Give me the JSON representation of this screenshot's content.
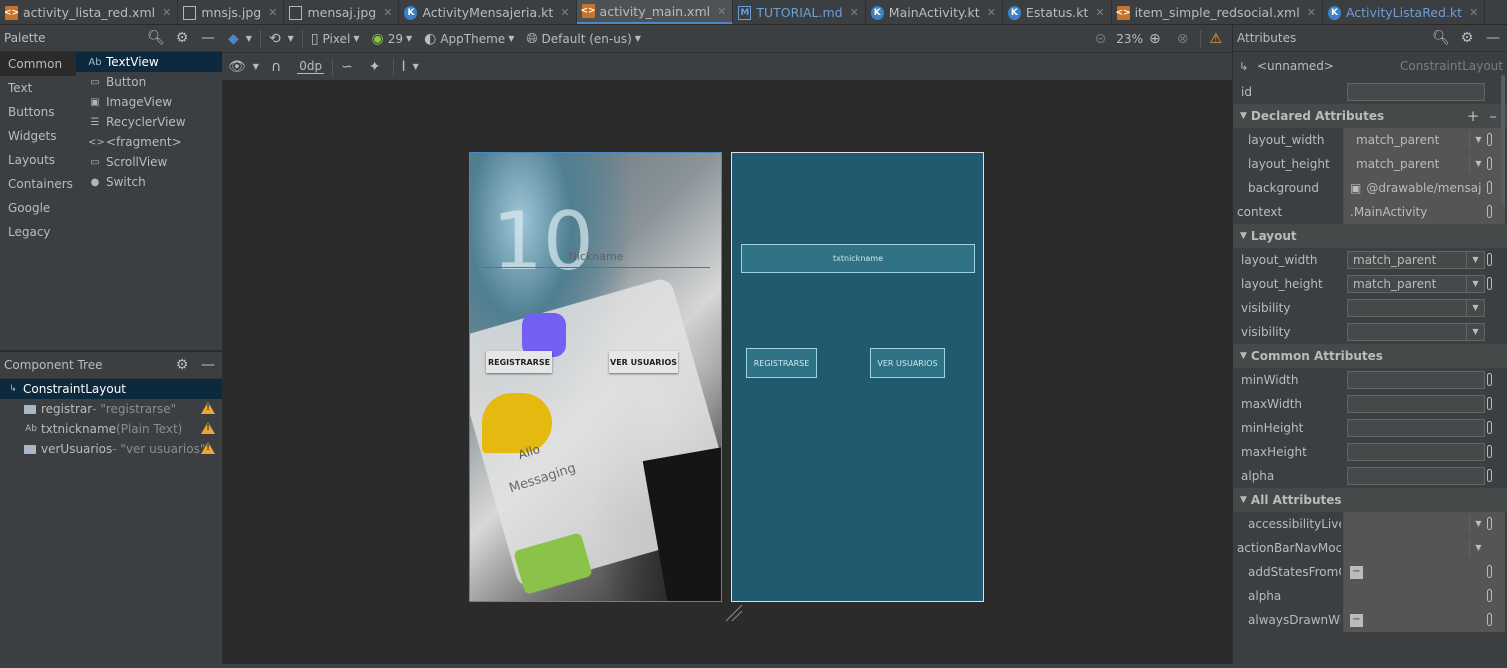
{
  "tabs": [
    {
      "label": "activity_lista_red.xml",
      "icon": "xml-file-icon",
      "kind": "xml",
      "active": false
    },
    {
      "label": "mnsjs.jpg",
      "icon": "image-file-icon",
      "kind": "img",
      "active": false
    },
    {
      "label": "mensaj.jpg",
      "icon": "image-file-icon",
      "kind": "img",
      "active": false
    },
    {
      "label": "ActivityMensajeria.kt",
      "icon": "kotlin-file-icon",
      "kind": "kt",
      "active": false
    },
    {
      "label": "activity_main.xml",
      "icon": "xml-file-icon",
      "kind": "xml",
      "active": true
    },
    {
      "label": "TUTORIAL.md",
      "icon": "markdown-file-icon",
      "kind": "md",
      "active": false,
      "blue": true
    },
    {
      "label": "MainActivity.kt",
      "icon": "kotlin-file-icon",
      "kind": "kt",
      "active": false
    },
    {
      "label": "Estatus.kt",
      "icon": "kotlin-file-icon",
      "kind": "kt",
      "active": false
    },
    {
      "label": "item_simple_redsocial.xml",
      "icon": "xml-file-icon",
      "kind": "xml",
      "active": false
    },
    {
      "label": "ActivityListaRed.kt",
      "icon": "kotlin-file-icon",
      "kind": "kt",
      "active": false,
      "blue": true
    }
  ],
  "palette": {
    "title": "Palette",
    "categories": [
      "Common",
      "Text",
      "Buttons",
      "Widgets",
      "Layouts",
      "Containers",
      "Google",
      "Legacy"
    ],
    "selected_category": "Common",
    "items": [
      {
        "glyph": "Ab",
        "label": "TextView"
      },
      {
        "glyph": "▭",
        "label": "Button"
      },
      {
        "glyph": "▣",
        "label": "ImageView"
      },
      {
        "glyph": "☰",
        "label": "RecyclerView"
      },
      {
        "glyph": "<>",
        "label": "<fragment>"
      },
      {
        "glyph": "▭",
        "label": "ScrollView"
      },
      {
        "glyph": "●",
        "label": "Switch"
      }
    ]
  },
  "component_tree": {
    "title": "Component Tree",
    "root": "ConstraintLayout",
    "children": [
      {
        "name": "registrar",
        "detail": "- \"registrarse\"",
        "icon": "button-icon",
        "warning": true
      },
      {
        "name": "txtnickname",
        "detail": "(Plain Text)",
        "icon": "text-field-icon",
        "warning": true
      },
      {
        "name": "verUsuarios",
        "detail": "- \"ver usuarios\"",
        "icon": "button-icon",
        "warning": true
      }
    ]
  },
  "toolbar": {
    "device": "Pixel",
    "api": "29",
    "theme": "AppTheme",
    "locale": "Default (en-us)",
    "zoom": "23%",
    "margin": "0dp"
  },
  "design": {
    "nickname_hint": "Nickname",
    "register_btn": "REGISTRARSE",
    "users_btn": "VER USUARIOS",
    "bg_labels": {
      "allo": "Allo",
      "messaging": "Messaging",
      "digit": "10"
    }
  },
  "blueprint": {
    "field_label": "txtnickname",
    "register_btn": "REGISTRARSE",
    "users_btn": "VER USUARIOS"
  },
  "attributes": {
    "title": "Attributes",
    "element_name": "<unnamed>",
    "element_class": "ConstraintLayout",
    "id_label": "id",
    "declared": {
      "title": "Declared Attributes",
      "rows": [
        {
          "key": "layout_width",
          "value": "match_parent"
        },
        {
          "key": "layout_height",
          "value": "match_parent"
        },
        {
          "key": "background",
          "value": "@drawable/mensaj"
        },
        {
          "key": "context",
          "value": ".MainActivity"
        }
      ]
    },
    "layout": {
      "title": "Layout",
      "rows": [
        {
          "key": "layout_width",
          "value": "match_parent"
        },
        {
          "key": "layout_height",
          "value": "match_parent"
        },
        {
          "key": "visibility",
          "value": ""
        },
        {
          "key": "visibility",
          "value": ""
        }
      ]
    },
    "common": {
      "title": "Common Attributes",
      "rows": [
        "minWidth",
        "maxWidth",
        "minHeight",
        "maxHeight",
        "alpha"
      ]
    },
    "all": {
      "title": "All Attributes",
      "rows": [
        "accessibilityLiveRe",
        "actionBarNavMoc",
        "addStatesFromCh",
        "alpha",
        "alwaysDrawnWith"
      ]
    }
  },
  "colors": {
    "accent": "#4a88c7",
    "warning": "#f0a732",
    "blueprint": "#215a6e",
    "selection": "#0d293e"
  }
}
